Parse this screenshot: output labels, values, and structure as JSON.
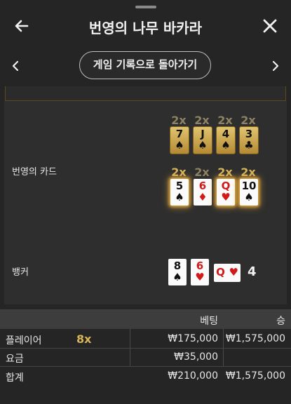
{
  "header": {
    "title": "번영의 나무 바카라",
    "back_icon": "arrow-left-icon",
    "close_icon": "close-x-icon"
  },
  "nav": {
    "history_button": "게임 기록으로 돌아가기",
    "prev_icon": "chevron-left-icon",
    "next_icon": "chevron-right-icon"
  },
  "hands": {
    "prosperity": {
      "label": "번영의 카드",
      "top_row": {
        "multipliers": [
          "2x",
          "2x",
          "2x",
          "2x"
        ],
        "cards": [
          {
            "rank": "7",
            "suit": "♠"
          },
          {
            "rank": "J",
            "suit": "♠"
          },
          {
            "rank": "4",
            "suit": "♠"
          },
          {
            "rank": "3",
            "suit": "♣"
          }
        ]
      },
      "bottom_row": {
        "multipliers": [
          "2x",
          "2x",
          "2x",
          "2x"
        ],
        "cards": [
          {
            "rank": "5",
            "suit": "♠"
          },
          {
            "rank": "6",
            "suit": "♦"
          },
          {
            "rank": "Q",
            "suit": "♥"
          },
          {
            "rank": "10",
            "suit": "♠"
          }
        ]
      }
    },
    "banker": {
      "label": "뱅커",
      "cards": [
        {
          "rank": "8",
          "suit": "♠"
        },
        {
          "rank": "6",
          "suit": "♥"
        },
        {
          "rank": "Q",
          "suit": "♥"
        }
      ],
      "total": "4"
    }
  },
  "table": {
    "headers": {
      "bet": "베팅",
      "win": "승"
    },
    "rows": [
      {
        "label": "플레이어",
        "multiplier": "8x",
        "bet": "₩175,000",
        "win": "₩1,575,000"
      },
      {
        "label": "요금",
        "multiplier": "",
        "bet": "₩35,000",
        "win": ""
      },
      {
        "label": "합계",
        "multiplier": "",
        "bet": "₩210,000",
        "win": "₩1,575,000"
      }
    ]
  },
  "colors": {
    "background": "#252525",
    "gold": "#d8b45a",
    "red_suit": "#d21a1a"
  }
}
